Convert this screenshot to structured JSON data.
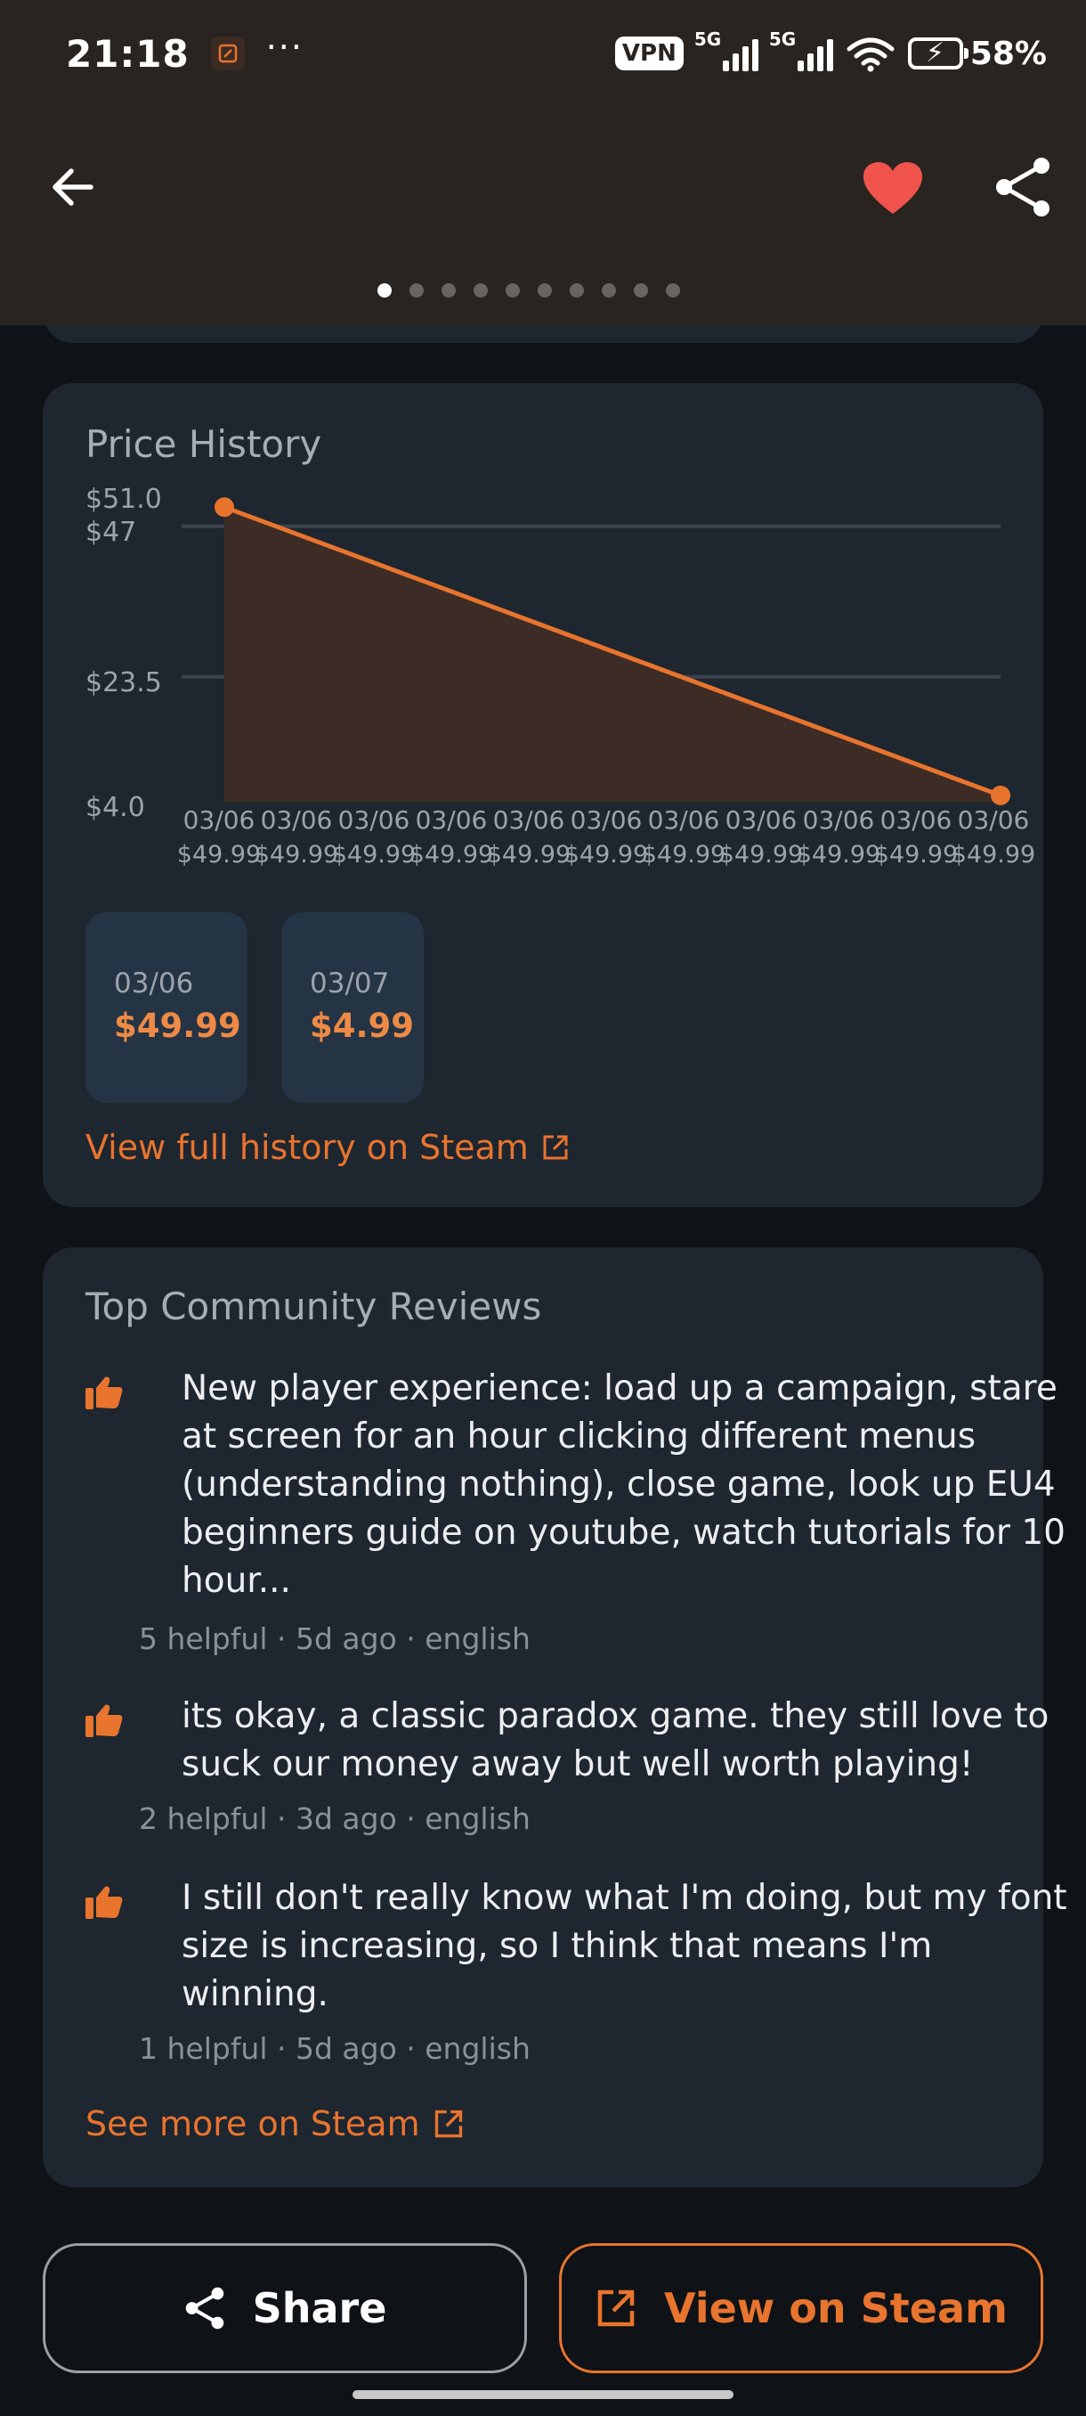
{
  "status_bar": {
    "time": "21:18",
    "dots": "···",
    "vpn": "VPN",
    "net1": "5G",
    "net2": "5G",
    "battery": "58%"
  },
  "header": {
    "pager_count": 10,
    "pager_active": 0,
    "accent": "#e8742e",
    "favorite_color": "#f0544c"
  },
  "price_history": {
    "title": "Price History",
    "link": "View full history on Steam",
    "chips": [
      {
        "date": "03/06",
        "price": "$49.99"
      },
      {
        "date": "03/07",
        "price": "$4.99"
      }
    ],
    "chart_data": {
      "type": "line",
      "yticks": [
        "$51.0",
        "$47",
        "$23.5",
        "$4.0"
      ],
      "ylim": [
        4.0,
        51.0
      ],
      "x": [
        "03/06",
        "03/06",
        "03/06",
        "03/06",
        "03/06",
        "03/06",
        "03/06",
        "03/06",
        "03/06",
        "03/06",
        "03/06"
      ],
      "x_prices": [
        "$49.99",
        "$49.99",
        "$49.99",
        "$49.99",
        "$49.99",
        "$49.99",
        "$49.99",
        "$49.99",
        "$49.99",
        "$49.99",
        "$49.99"
      ],
      "series": [
        {
          "values": [
            49.99,
            4.99
          ]
        }
      ],
      "grid": true
    }
  },
  "reviews": {
    "title": "Top Community Reviews",
    "items": [
      {
        "text": "New player experience: load up a campaign, stare at screen for an hour clicking different menus (understanding nothing), close game, look up EU4 beginners guide on youtube, watch tutorials for 10 hour...",
        "meta": "5 helpful · 5d ago · english"
      },
      {
        "text": "its okay, a classic paradox game. they still love to suck our money away but well worth playing!",
        "meta": "2 helpful · 3d ago · english"
      },
      {
        "text": "I still don't really know what I'm doing, but my font size is increasing, so I think that means I'm winning.",
        "meta": "1 helpful · 5d ago · english"
      }
    ],
    "link": "See more on Steam"
  },
  "actions": {
    "share": "Share",
    "view_on_steam": "View on Steam"
  }
}
